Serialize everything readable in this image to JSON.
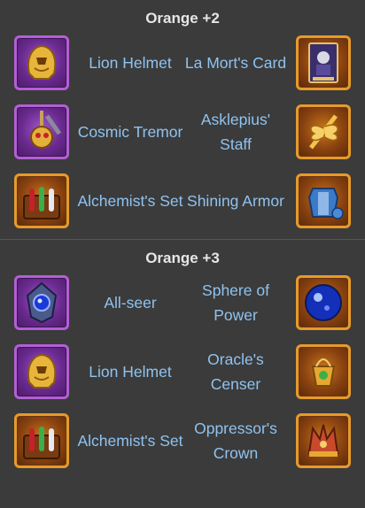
{
  "sections": [
    {
      "title": "Orange +2",
      "rows": [
        {
          "left_label": "Lion Helmet",
          "left_icon": "lion-helmet-icon",
          "left_frame": "purple",
          "right_label": "La Mort's Card",
          "right_icon": "la-morts-card-icon",
          "right_frame": "orange"
        },
        {
          "left_label": "Cosmic Tremor",
          "left_icon": "cosmic-tremor-icon",
          "left_frame": "purple",
          "right_label": "Asklepius' Staff",
          "right_icon": "asklepius-staff-icon",
          "right_frame": "orange"
        },
        {
          "left_label": "Alchemist's Set",
          "left_icon": "alchemists-set-icon",
          "left_frame": "orange",
          "right_label": "Shining Armor",
          "right_icon": "shining-armor-icon",
          "right_frame": "orange"
        }
      ]
    },
    {
      "title": "Orange +3",
      "rows": [
        {
          "left_label": "All-seer",
          "left_icon": "all-seer-icon",
          "left_frame": "purple",
          "right_label": "Sphere of Power",
          "right_icon": "sphere-of-power-icon",
          "right_frame": "orange"
        },
        {
          "left_label": "Lion Helmet",
          "left_icon": "lion-helmet-icon",
          "left_frame": "purple",
          "right_label": "Oracle's Censer",
          "right_icon": "oracles-censer-icon",
          "right_frame": "orange"
        },
        {
          "left_label": "Alchemist's Set",
          "left_icon": "alchemists-set-icon",
          "left_frame": "orange",
          "right_label": "Oppressor's Crown",
          "right_icon": "oppressors-crown-icon",
          "right_frame": "orange"
        }
      ]
    }
  ],
  "colors": {
    "background": "#3b3b3b",
    "title_text": "#e6e6e6",
    "label_text": "#8fc3f0",
    "frame_purple": "#b35fd6",
    "frame_orange": "#e79a2a"
  }
}
